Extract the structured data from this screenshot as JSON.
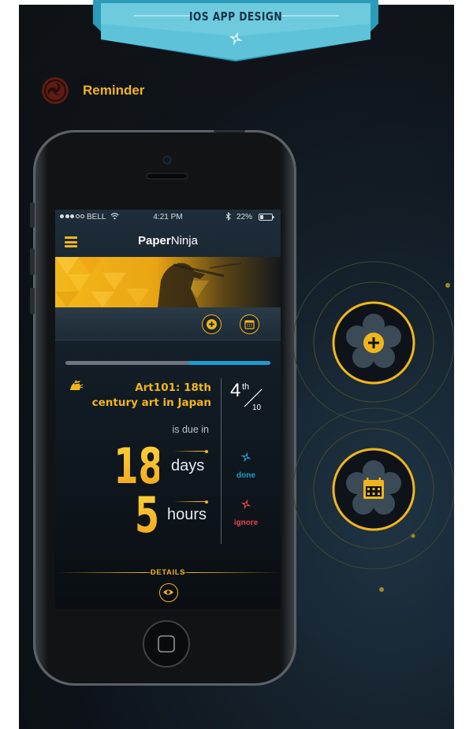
{
  "header": {
    "ribbon_title": "IOS APP DESIGN",
    "section_title": "Reminder"
  },
  "status_bar": {
    "carrier": "BELL",
    "time": "4:21 PM",
    "battery": "22%"
  },
  "app": {
    "title_bold": "Paper",
    "title_light": "Ninja"
  },
  "progress": {
    "value": 0.4
  },
  "task": {
    "title": "Art101: 18th century art in Japan",
    "due_prefix": "is due in",
    "rank": "4",
    "rank_suffix": "th",
    "rank_total": "10",
    "days_value": "18",
    "days_label": "days",
    "hours_value": "5",
    "hours_label": "hours"
  },
  "actions": {
    "done_label": "done",
    "done_color": "#1e9bcf",
    "ignore_label": "ignore",
    "ignore_color": "#e0434b"
  },
  "footer": {
    "details_label": "DETAILS"
  },
  "colors": {
    "accent": "#f1b51c",
    "blue": "#1e9bcf",
    "red": "#e0434b"
  },
  "icons": {
    "ribbon": "shuriken-icon",
    "section": "tomoe-logo-icon",
    "add": "plus-icon",
    "calendar": "calendar-icon",
    "task": "ninja-icon",
    "details": "eye-icon"
  }
}
